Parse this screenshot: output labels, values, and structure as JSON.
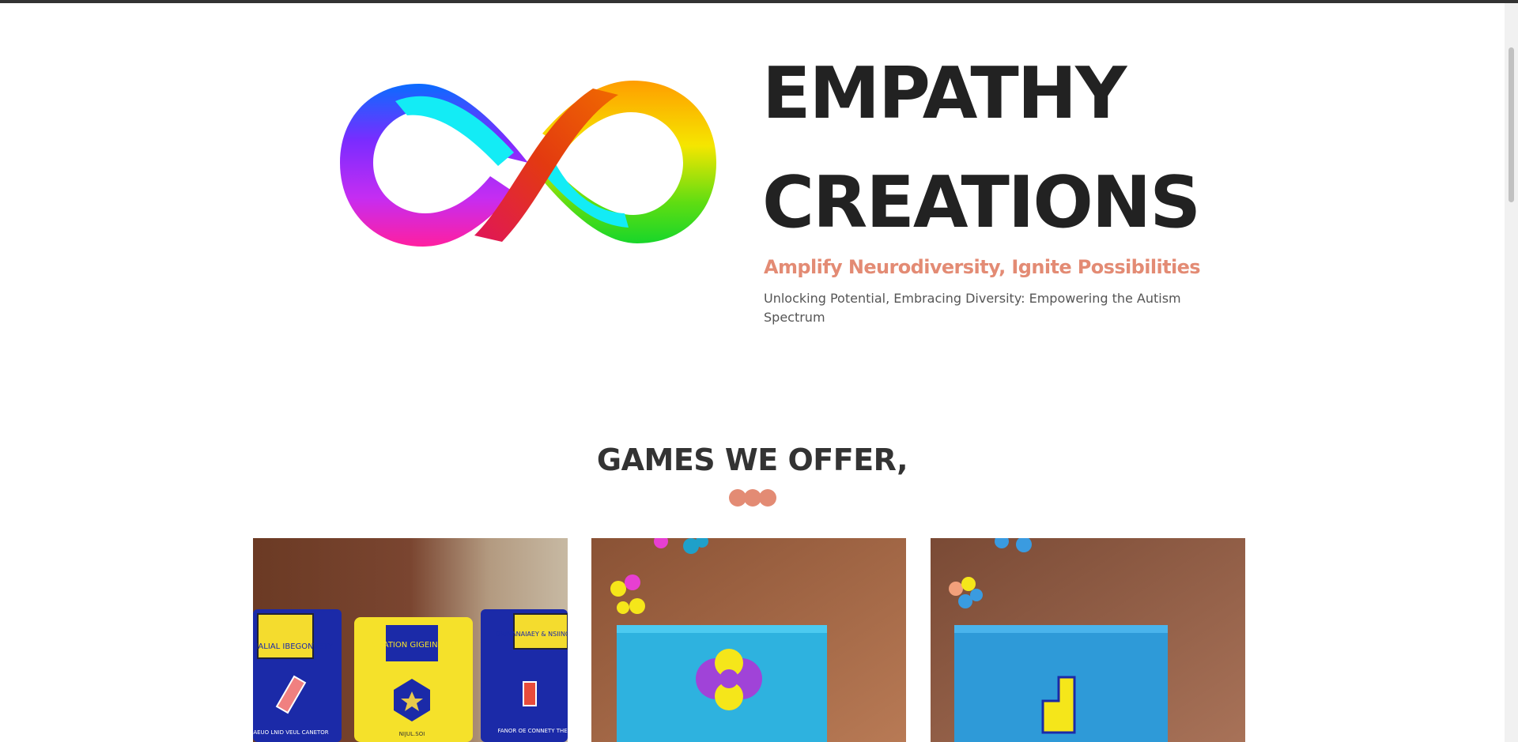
{
  "hero": {
    "title_line1": "EMPATHY",
    "title_line2": "CREATIONS",
    "tagline": "Amplify Neurodiversity, Ignite Possibilities",
    "description": "Unlocking Potential, Embracing Diversity: Empowering the Autism Spectrum"
  },
  "games_section": {
    "title": "GAMES WE OFFER,"
  },
  "cards": [
    {
      "box_labels": [
        "NNIAIALIAL IBEGONTETY",
        "NLIATION GIGEINCES",
        "DWNANAIAEY & NSIINOSSSL"
      ],
      "caption_left": "AEUO LNID VEUL CANETOR",
      "caption_mid": "NIJUL.SOI",
      "caption_right": "FANOR OE CONNETY THE GAE"
    },
    {},
    {}
  ],
  "colors": {
    "accent": "#e38b74",
    "heading": "#222222",
    "text": "#555555"
  }
}
